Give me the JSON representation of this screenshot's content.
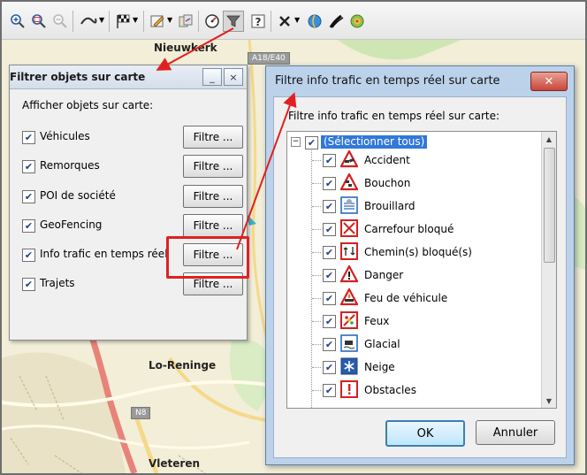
{
  "map": {
    "town1": "Nieuwkerk",
    "town2": "Lo-Reninge",
    "town3": "Vleteren",
    "road_badge1": "A18/E40",
    "road_badge2": "N8"
  },
  "filter_panel": {
    "title": "Filtrer objets sur carte",
    "minimize_icon": "_",
    "close_icon": "×",
    "subtitle": "Afficher objets sur carte:",
    "rows": [
      {
        "label": "Véhicules",
        "checked": true,
        "button": "Filtre ..."
      },
      {
        "label": "Remorques",
        "checked": true,
        "button": "Filtre ..."
      },
      {
        "label": "POI de société",
        "checked": true,
        "button": "Filtre ..."
      },
      {
        "label": "GeoFencing",
        "checked": true,
        "button": "Filtre ..."
      },
      {
        "label": "Info trafic en temps réel",
        "checked": true,
        "button": "Filtre ..."
      },
      {
        "label": "Trajets",
        "checked": true,
        "button": "Filtre ..."
      }
    ],
    "highlighted_row": "Info trafic en temps réel"
  },
  "traffic_dialog": {
    "title": "Filtre info trafic en temps réel sur carte",
    "close_icon": "✕",
    "subtitle": "Filtre info trafic en temps réel sur carte:",
    "select_all": "(Sélectionner tous)",
    "items": [
      {
        "label": "Accident",
        "checked": true,
        "icon": "accident-icon"
      },
      {
        "label": "Bouchon",
        "checked": true,
        "icon": "traffic-jam-icon"
      },
      {
        "label": "Brouillard",
        "checked": true,
        "icon": "fog-icon"
      },
      {
        "label": "Carrefour bloqué",
        "checked": true,
        "icon": "blocked-junction-icon"
      },
      {
        "label": "Chemin(s) bloqué(s)",
        "checked": true,
        "icon": "blocked-road-icon"
      },
      {
        "label": "Danger",
        "checked": true,
        "icon": "danger-icon"
      },
      {
        "label": "Feu de véhicule",
        "checked": true,
        "icon": "vehicle-fire-icon"
      },
      {
        "label": "Feux",
        "checked": true,
        "icon": "traffic-lights-icon"
      },
      {
        "label": "Glacial",
        "checked": true,
        "icon": "ice-icon"
      },
      {
        "label": "Neige",
        "checked": true,
        "icon": "snow-icon"
      },
      {
        "label": "Obstacles",
        "checked": true,
        "icon": "obstacle-icon"
      }
    ],
    "ok_label": "OK",
    "cancel_label": "Annuler"
  },
  "colors": {
    "highlight": "#e02020",
    "selection": "#3178d8",
    "dialog_frame": "#bcd2ea"
  }
}
